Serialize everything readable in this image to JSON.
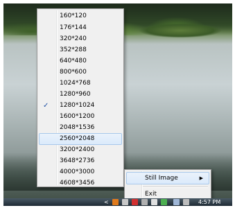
{
  "resolution_menu": {
    "items": [
      {
        "label": "160*120"
      },
      {
        "label": "176*144"
      },
      {
        "label": "320*240"
      },
      {
        "label": "352*288"
      },
      {
        "label": "640*480"
      },
      {
        "label": "800*600"
      },
      {
        "label": "1024*768"
      },
      {
        "label": "1280*960"
      },
      {
        "label": "1280*1024",
        "checked": true
      },
      {
        "label": "1600*1200"
      },
      {
        "label": "2048*1536"
      },
      {
        "label": "2560*2048",
        "highlighted": true
      },
      {
        "label": "3200*2400"
      },
      {
        "label": "3648*2736"
      },
      {
        "label": "4000*3000"
      },
      {
        "label": "4608*3456"
      }
    ],
    "check_glyph": "✓"
  },
  "tray_menu": {
    "still_image": "Still Image",
    "submenu_arrow": "▶",
    "exit": "Exit"
  },
  "taskbar": {
    "chevron": "<",
    "clock": "4:57 PM"
  },
  "colors": {
    "menu_bg": "#f0f0f0",
    "highlight": "#dbeafb",
    "highlight_border": "#a8c8eb",
    "check": "#1e4fa3"
  }
}
